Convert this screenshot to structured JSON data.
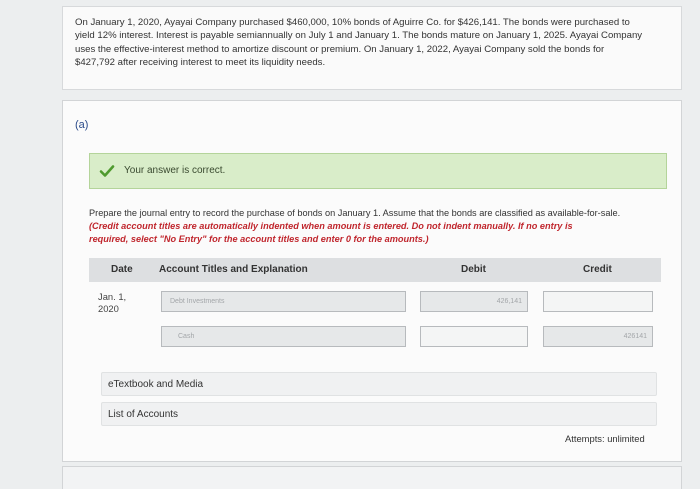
{
  "problem": {
    "lines": [
      "On January 1, 2020, Ayayai Company purchased $460,000, 10% bonds of Aguirre Co. for $426,141. The bonds were purchased to",
      "yield 12% interest. Interest is payable semiannually on July 1 and January 1. The bonds mature on January 1, 2025. Ayayai Company",
      "uses the effective-interest method to amortize discount or premium. On January 1, 2022, Ayayai Company sold the bonds for",
      "$427,792 after receiving interest to meet its liquidity needs."
    ]
  },
  "part": {
    "label": "(a)"
  },
  "feedback": {
    "icon": "check-icon",
    "text": "Your answer is correct.",
    "color": "#d9edc9",
    "check_color": "#4f9a2e"
  },
  "instructions": {
    "plain": "Prepare the journal entry to record the purchase of bonds on January 1. Assume that the bonds are classified as available-for-sale.",
    "emphasis_line1": "(Credit account titles are automatically indented when amount is entered. Do not indent manually. If no entry is",
    "emphasis_line2": "required, select \"No Entry\" for the account titles and enter 0 for the amounts.)"
  },
  "table": {
    "headers": {
      "date": "Date",
      "account": "Account Titles and Explanation",
      "debit": "Debit",
      "credit": "Credit"
    },
    "date_line1": "Jan. 1,",
    "date_line2": "2020",
    "rows": [
      {
        "account": "Debt Investments",
        "debit": "426,141",
        "credit": ""
      },
      {
        "account": "Cash",
        "debit": "",
        "credit": "426141"
      }
    ]
  },
  "links": {
    "textbook": "eTextbook and Media",
    "accounts": "List of Accounts"
  },
  "attempts": "Attempts: unlimited"
}
